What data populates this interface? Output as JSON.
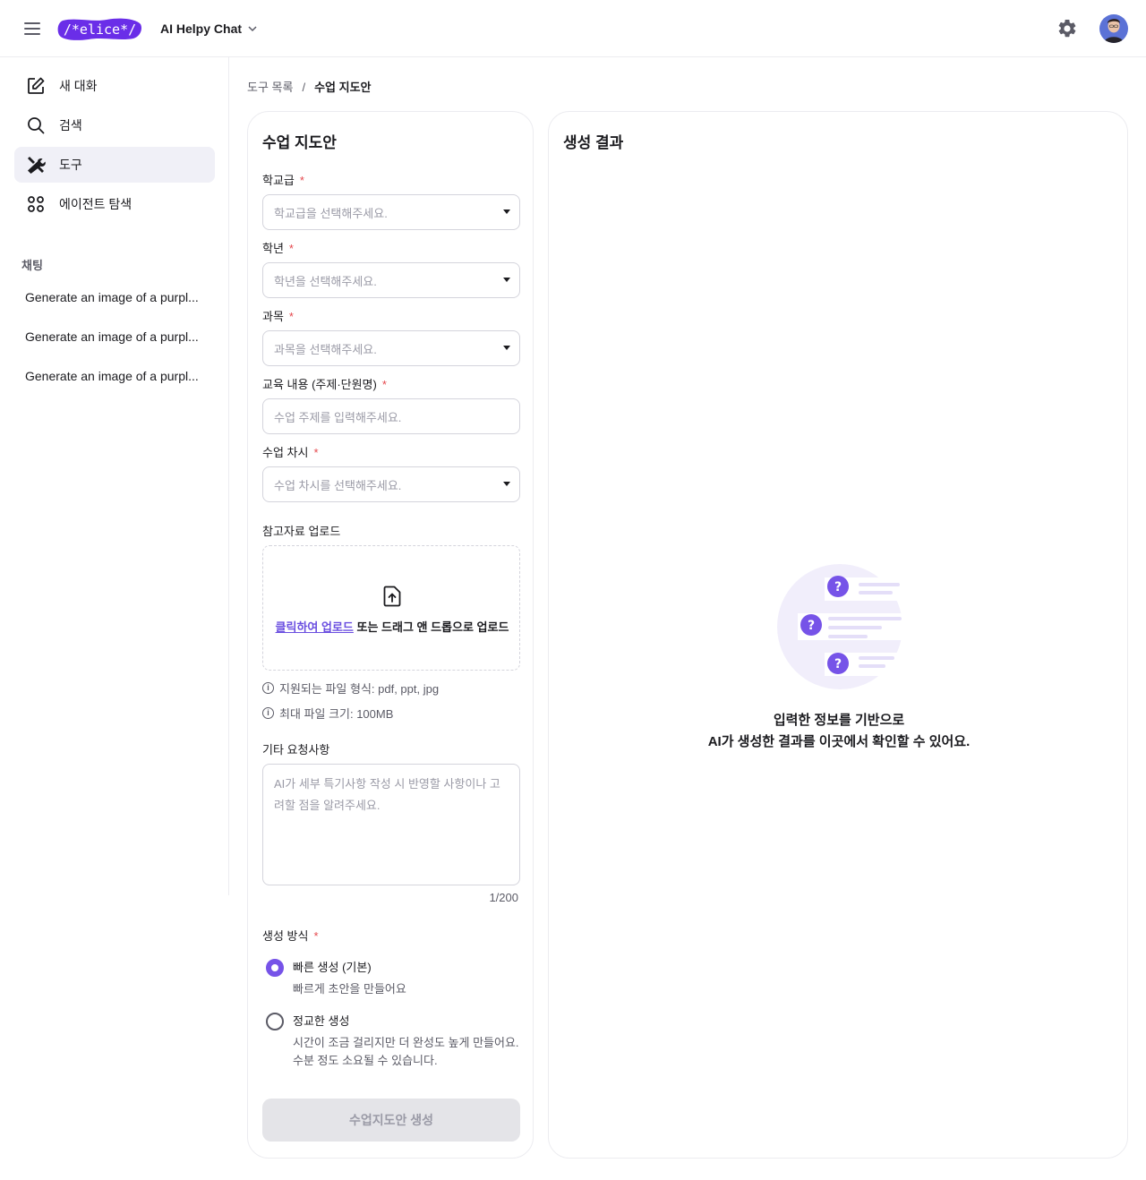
{
  "header": {
    "logo_text": "/*elice*/",
    "app_name": "AI Helpy Chat",
    "icons": {
      "menu": "hamburger-icon",
      "dropdown": "chevron-down-icon",
      "settings": "gear-icon"
    }
  },
  "sidebar": {
    "nav": [
      {
        "label": "새 대화",
        "icon": "edit-icon"
      },
      {
        "label": "검색",
        "icon": "search-icon"
      },
      {
        "label": "도구",
        "icon": "tools-icon",
        "active": true
      },
      {
        "label": "에이전트 탐색",
        "icon": "grid-icon"
      }
    ],
    "section_title": "채팅",
    "chats": [
      "Generate an image of a purpl...",
      "Generate an image of a purpl...",
      "Generate an image of a purpl..."
    ]
  },
  "breadcrumb": {
    "parent": "도구 목록",
    "separator": "/",
    "current": "수업 지도안"
  },
  "form": {
    "title": "수업 지도안",
    "required_mark": "*",
    "fields": [
      {
        "label": "학교급",
        "placeholder": "학교급을 선택해주세요."
      },
      {
        "label": "학년",
        "placeholder": "학년을 선택해주세요."
      },
      {
        "label": "과목",
        "placeholder": "과목을 선택해주세요."
      },
      {
        "label": "교육 내용 (주제·단원명)",
        "placeholder": "수업 주제를 입력해주세요."
      },
      {
        "label": "수업 차시",
        "placeholder": "수업 차시를 선택해주세요."
      }
    ],
    "upload": {
      "label": "참고자료 업로드",
      "link_text": "클릭하여 업로드",
      "rest_text": " 또는 드래그 앤 드롭으로 업로드",
      "hint_formats": "지원되는 파일 형식: pdf, ppt, jpg",
      "hint_size": "최대 파일 크기: 100MB"
    },
    "notes": {
      "label": "기타 요청사항",
      "placeholder": "AI가 세부 특기사항 작성 시 반영할 사항이나 고려할 점을 알려주세요.",
      "counter": "1/200"
    },
    "mode": {
      "label": "생성 방식",
      "options": [
        {
          "title": "빠른 생성 (기본)",
          "desc": "빠르게 초안을 만들어요",
          "checked": true
        },
        {
          "title": "정교한 생성",
          "desc_line1": "시간이 조금 걸리지만 더 완성도 높게 만들어요.",
          "desc_line2": "수분 정도 소요될 수 있습니다.",
          "checked": false
        }
      ]
    },
    "submit_label": "수업지도안 생성"
  },
  "result": {
    "title": "생성 결과",
    "empty_line1": "입력한 정보를 기반으로",
    "empty_line2": "AI가 생성한 결과를 이곳에서 확인할 수 있어요."
  },
  "colors": {
    "accent": "#7653e8",
    "required": "#e5484d",
    "illustration_bg": "#f1eefb"
  }
}
